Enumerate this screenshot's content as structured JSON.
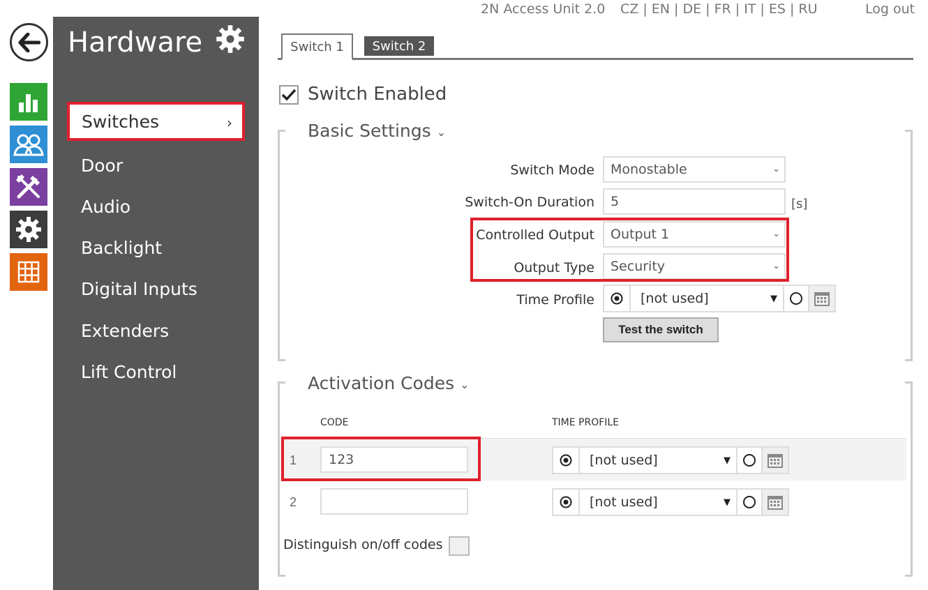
{
  "header": {
    "product": "2N Access Unit 2.0",
    "languages": "CZ | EN | DE | FR | IT | ES | RU",
    "logout": "Log out"
  },
  "rail": {
    "icons": [
      "back-arrow-icon",
      "status-chart-icon",
      "directory-users-icon",
      "hardware-tools-icon",
      "settings-gear-icon",
      "services-grid-icon"
    ]
  },
  "sidebar": {
    "title": "Hardware",
    "items": [
      {
        "label": "Switches",
        "active": true
      },
      {
        "label": "Door"
      },
      {
        "label": "Audio"
      },
      {
        "label": "Backlight"
      },
      {
        "label": "Digital Inputs"
      },
      {
        "label": "Extenders"
      },
      {
        "label": "Lift Control"
      }
    ]
  },
  "tabs": [
    {
      "label": "Switch 1",
      "active": true
    },
    {
      "label": "Switch 2"
    }
  ],
  "switch_enabled": {
    "label": "Switch Enabled",
    "checked": true
  },
  "basic": {
    "title": "Basic Settings",
    "switch_mode_label": "Switch Mode",
    "switch_mode_value": "Monostable",
    "duration_label": "Switch-On Duration",
    "duration_value": "5",
    "duration_unit": "[s]",
    "controlled_output_label": "Controlled Output",
    "controlled_output_value": "Output 1",
    "output_type_label": "Output Type",
    "output_type_value": "Security",
    "time_profile_label": "Time Profile",
    "time_profile_value": "[not used]",
    "test_button": "Test the switch"
  },
  "codes": {
    "title": "Activation Codes",
    "col_code": "CODE",
    "col_time_profile": "TIME PROFILE",
    "rows": [
      {
        "num": "1",
        "code": "123",
        "time_profile": "[not used]"
      },
      {
        "num": "2",
        "code": "",
        "time_profile": "[not used]"
      }
    ],
    "distinguish_label": "Distinguish on/off codes"
  },
  "colors": {
    "highlight": "#e0202d",
    "sidebar_bg": "#575757"
  }
}
